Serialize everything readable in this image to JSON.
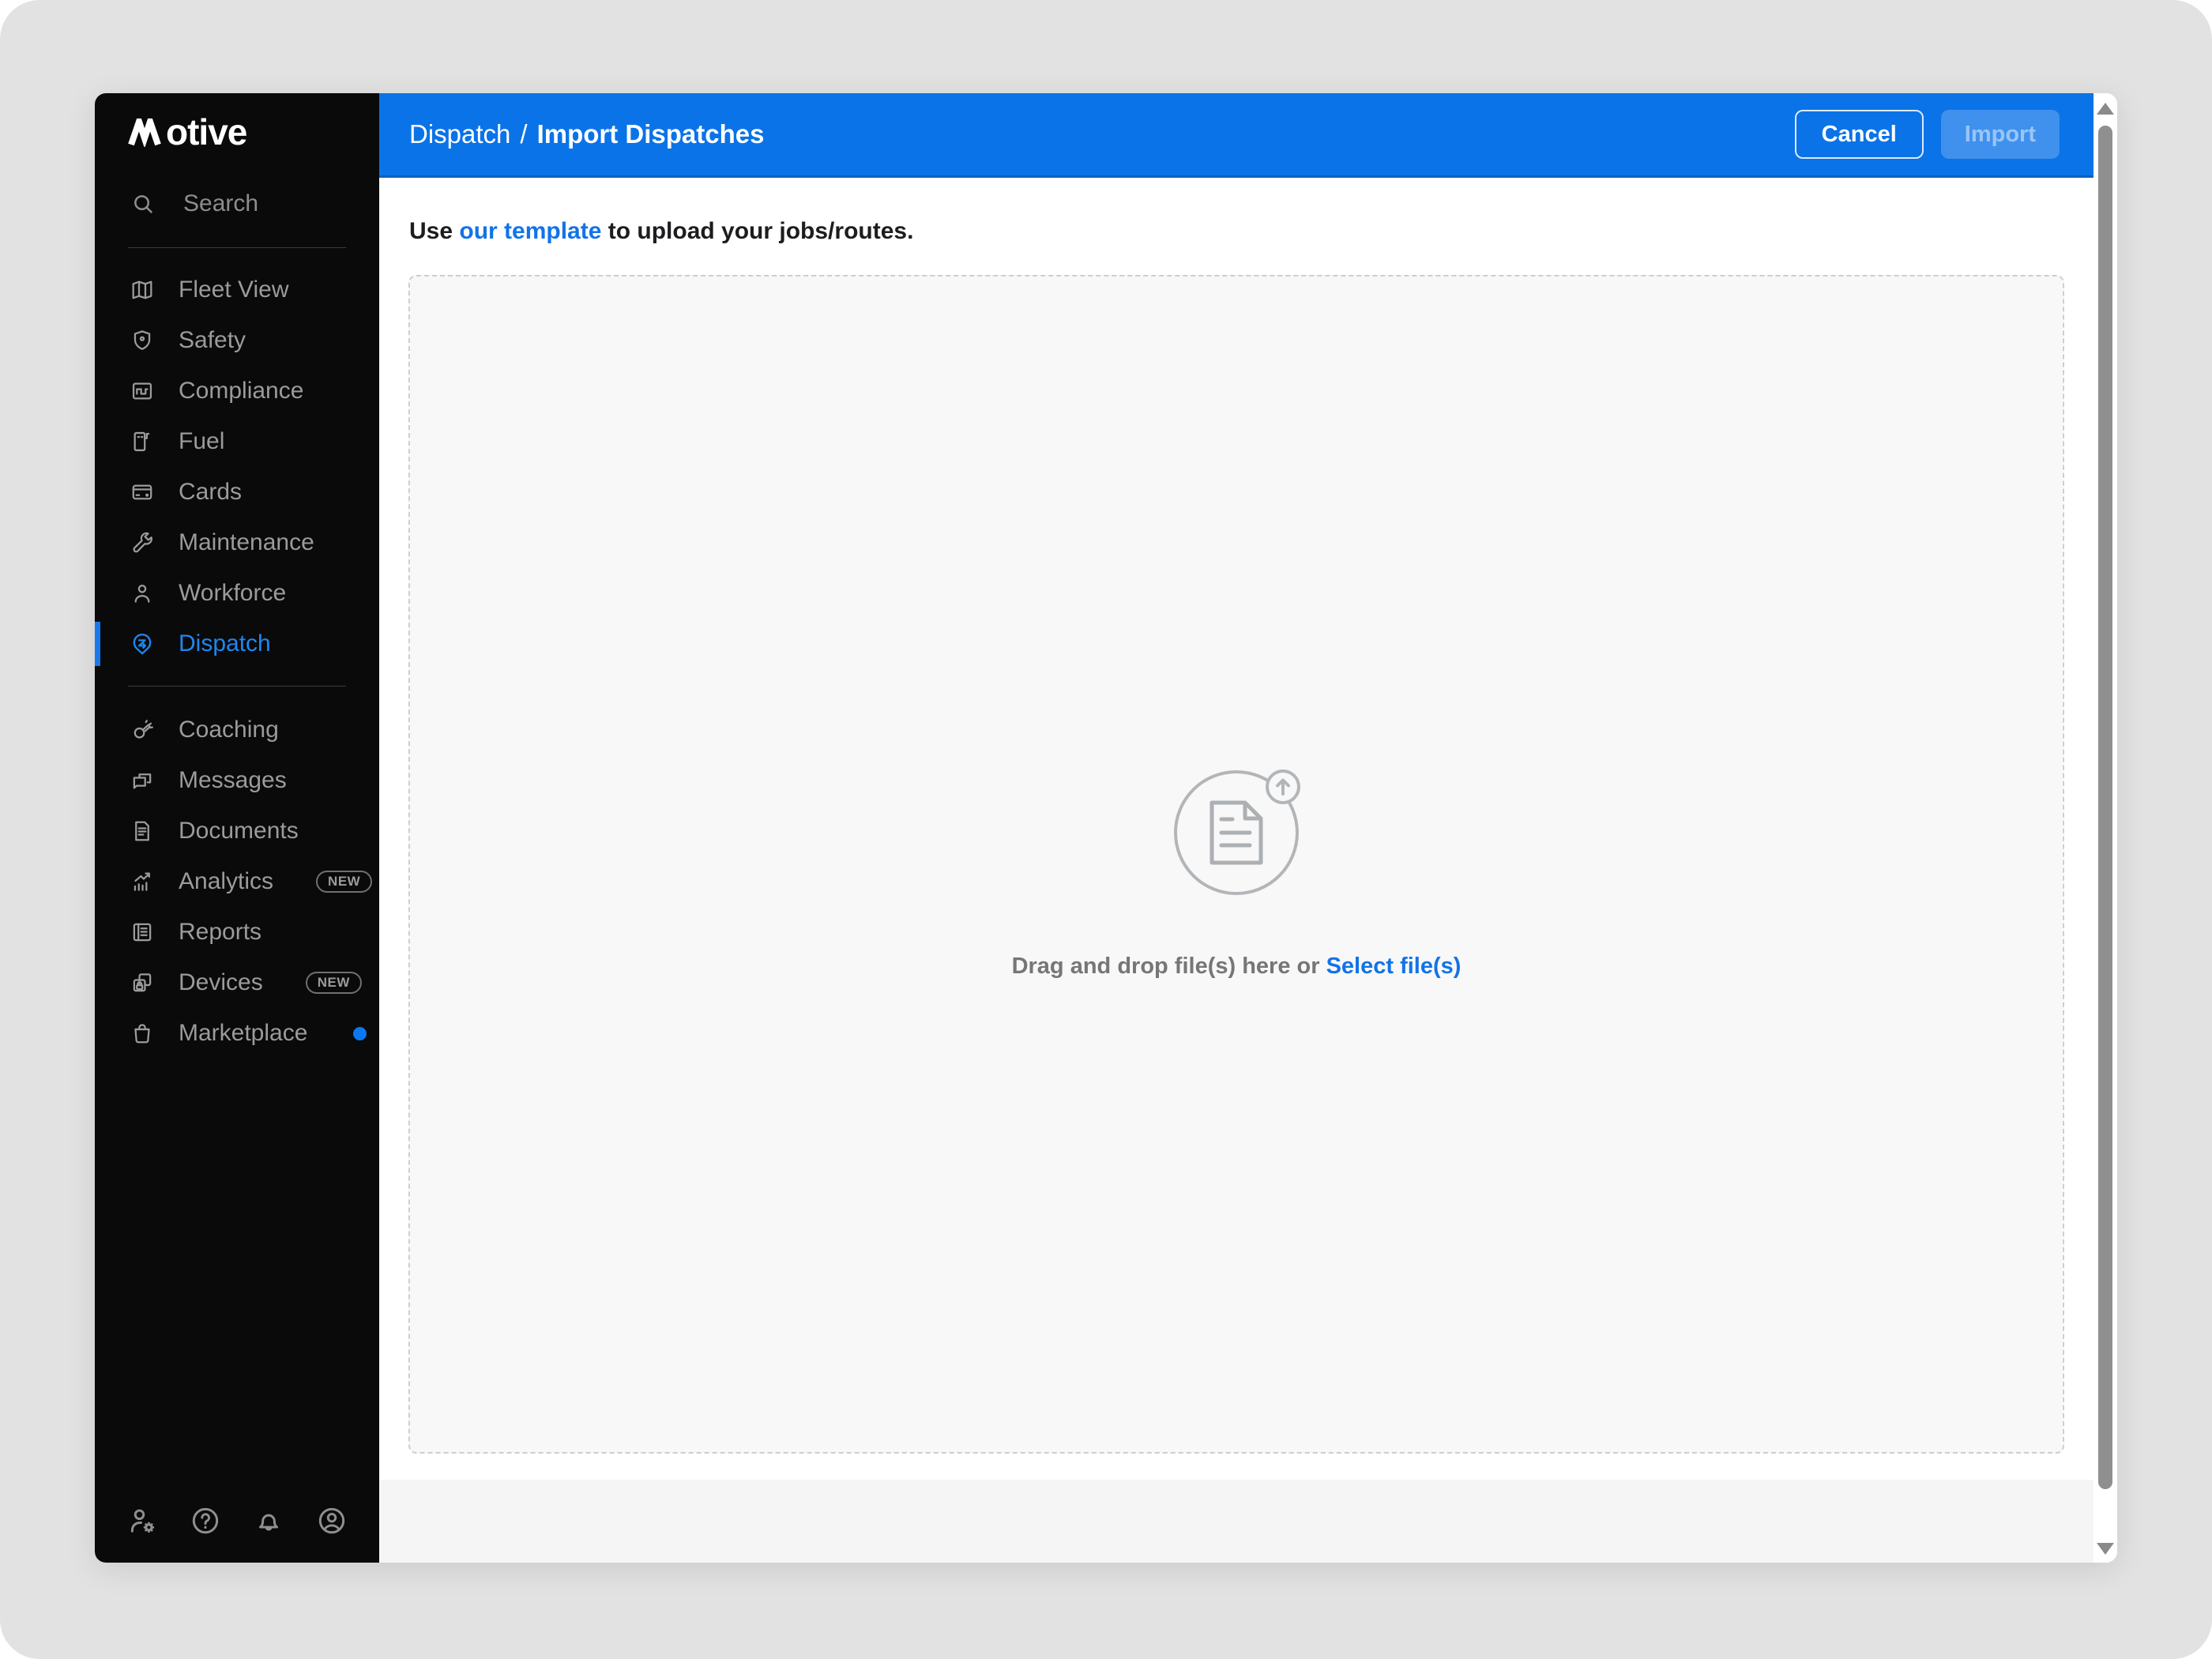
{
  "colors": {
    "header_blue": "#0a73e8",
    "link_blue": "#1273e8",
    "active_blue": "#1e87f0",
    "sidebar_bg": "#0a0a0b",
    "dot_blue": "#0b78f0"
  },
  "sidebar": {
    "logo": {
      "brand": "motive",
      "wordmark_suffix": "otive"
    },
    "search_label": "Search",
    "items": [
      {
        "id": "fleet-view",
        "label": "Fleet View",
        "icon": "map-icon"
      },
      {
        "id": "safety",
        "label": "Safety",
        "icon": "shield-icon"
      },
      {
        "id": "compliance",
        "label": "Compliance",
        "icon": "clipboard-route-icon"
      },
      {
        "id": "fuel",
        "label": "Fuel",
        "icon": "fuel-pump-icon"
      },
      {
        "id": "cards",
        "label": "Cards",
        "icon": "credit-card-icon"
      },
      {
        "id": "maintenance",
        "label": "Maintenance",
        "icon": "wrench-icon"
      },
      {
        "id": "workforce",
        "label": "Workforce",
        "icon": "person-icon"
      },
      {
        "id": "dispatch",
        "label": "Dispatch",
        "icon": "dispatch-pin-icon",
        "active": true
      },
      {
        "type": "divider"
      },
      {
        "id": "coaching",
        "label": "Coaching",
        "icon": "whistle-icon"
      },
      {
        "id": "messages",
        "label": "Messages",
        "icon": "chat-icon"
      },
      {
        "id": "documents",
        "label": "Documents",
        "icon": "document-icon"
      },
      {
        "id": "analytics",
        "label": "Analytics",
        "icon": "analytics-icon",
        "badge": "NEW"
      },
      {
        "id": "reports",
        "label": "Reports",
        "icon": "report-icon"
      },
      {
        "id": "devices",
        "label": "Devices",
        "icon": "devices-icon",
        "badge": "NEW"
      },
      {
        "id": "marketplace",
        "label": "Marketplace",
        "icon": "shopping-bag-icon",
        "dot": true
      }
    ],
    "footer_icons": [
      {
        "id": "admin-settings",
        "icon": "user-gear-icon"
      },
      {
        "id": "help",
        "icon": "help-icon"
      },
      {
        "id": "notifications",
        "icon": "bell-icon"
      },
      {
        "id": "account",
        "icon": "account-icon"
      }
    ]
  },
  "header": {
    "breadcrumb_parent": "Dispatch",
    "breadcrumb_separator": "/",
    "breadcrumb_current": "Import Dispatches",
    "cancel_label": "Cancel",
    "import_label": "Import"
  },
  "content": {
    "intro": {
      "prefix": "Use ",
      "link": "our template",
      "suffix": " to upload your jobs/routes."
    },
    "dropzone": {
      "drag_text": "Drag and drop file(s) here or ",
      "select_link": "Select file(s)"
    }
  }
}
